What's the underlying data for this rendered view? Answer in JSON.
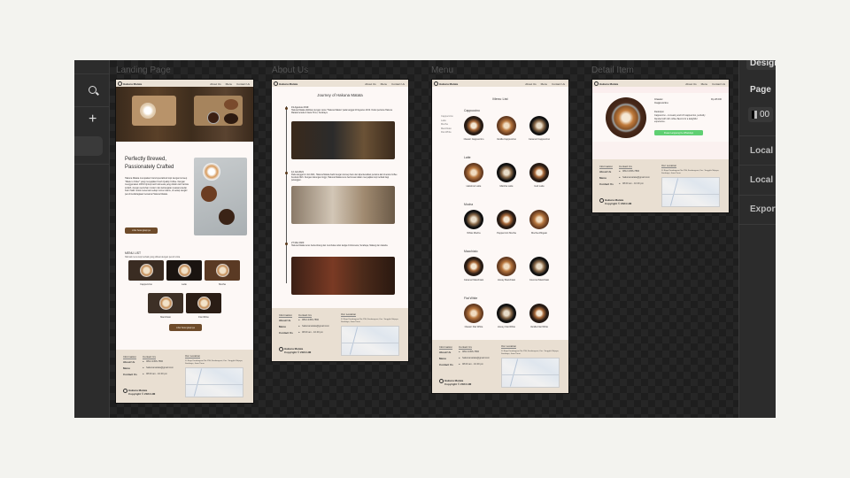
{
  "panel": {
    "design_tab": "Design",
    "page_label": "Page",
    "page_color": "00",
    "local_variables": "Local v",
    "local_styles": "Local s",
    "export": "Export"
  },
  "frames": {
    "landing": "Landing Page",
    "about": "About Us",
    "menu": "Menu",
    "detail": "Detail Item"
  },
  "nav": {
    "brand": "Hakuna Matata",
    "links": [
      "About Us",
      "Menu",
      "Contact Us"
    ]
  },
  "landing": {
    "headline": "Perfectly Brewed, Passionately Crafted",
    "paragraph": "Hakuna Matata merupakan brand specialized kopi dengan konsep \"Made to Order\" yang menyajikan Fresh Quality Coffee. Dengan menggunakan 100% biji kopi asli Indonesia yang diolah oleh barista terlatih, dengan sentuhan modern dan kehangatan suasana kedai. Kami hadir untuk menemani setiap momen kamu, di setiap cangkir penuh kebahagiaan bersama Hakuna Matata.",
    "cta": "Lihat Selengkapnya",
    "menu_title": "MENU LIST",
    "menu_sub": "Nikmati menu kopi terbaik yang dibuat dengan penuh cinta",
    "menu_items": [
      "Cappuccino",
      "Latte",
      "Mocha",
      "Macchiato",
      "Flat White"
    ],
    "menu_cta": "Lihat Selengkapnya"
  },
  "about": {
    "title": "Journey of Hakuna Matata",
    "events": [
      {
        "date": "19 Agustus 2019",
        "text": "Hakuna Matata didirikan dengan nama \"Hakuna Matata\" pada tanggal 19 Agustus 2019. Outlet pertama Hakuna Matata berada di Jawa Timur, Surabaya."
      },
      {
        "date": "12 Juli 2021",
        "text": "Pada tanggal 12 Juli 2021, Hakuna Matata hadir dengan konsep baru dan diperkenalkan pertama kali di acara Coffee Festival 2021. Dengan dukungan tinggi, Hakuna Matata terus berinovasi dalam menyajikan kopi terbaik bagi pelanggan."
      },
      {
        "date": "27 Mei 2023",
        "text": "Hakuna Matata terus berkembang dan membuka outlet ketiga di Indonesia, Surabaya, Malang dan Jakarta."
      }
    ]
  },
  "menu": {
    "title": "Menu List",
    "sidebar": [
      "Cappuccino",
      "Latte",
      "Mocha",
      "Macchiato",
      "Flat White"
    ],
    "sections": [
      {
        "name": "Cappuccino",
        "items": [
          "Classic Cappuccino",
          "Vanilla Cappuccino",
          "Caramel Cappuccino"
        ]
      },
      {
        "name": "Latte",
        "items": [
          "Hazelnut Latte",
          "Matcha Latte",
          "Iced Latte"
        ]
      },
      {
        "name": "Mocha",
        "items": [
          "White Mocha",
          "Peppermint Mocha",
          "Mocha Affogato"
        ]
      },
      {
        "name": "Macchiato",
        "items": [
          "Caramel Macchiato",
          "Honey Macchiato",
          "Coconut Macchiato"
        ]
      },
      {
        "name": "Flat White",
        "items": [
          "Classic Flat White",
          "Honey Flat White",
          "Vanilla Flat White"
        ]
      }
    ]
  },
  "detail": {
    "name1": "Classic",
    "name2": "Cappuccino",
    "price": "Rp 28.000",
    "desc_label": "Deskripsi",
    "desc": "Cappuccino – A creamy and rich cappuccino, perfectly blended with rich coffee flavors for a delightful experience.",
    "order": "Pesan Langsung Ke WhatsApp"
  },
  "footer": {
    "info_title": "Information",
    "contact_title": "Contact Us",
    "location_title": "Our Location",
    "info_links": [
      "About Us",
      "Menu",
      "Contact Us"
    ],
    "contacts": [
      "0812-3456-7890",
      "hakunamatata@gmail.com",
      "08.00 am - 10.00 pm"
    ],
    "address": "Jl. Raya Kendangsari No.17A, Kendangsari, Kec. Tenggilis Mejoyo, Surabaya, Jawa Timur",
    "brand": "Hakuna Matata",
    "copyright": "Copyright © 2024 HM"
  }
}
